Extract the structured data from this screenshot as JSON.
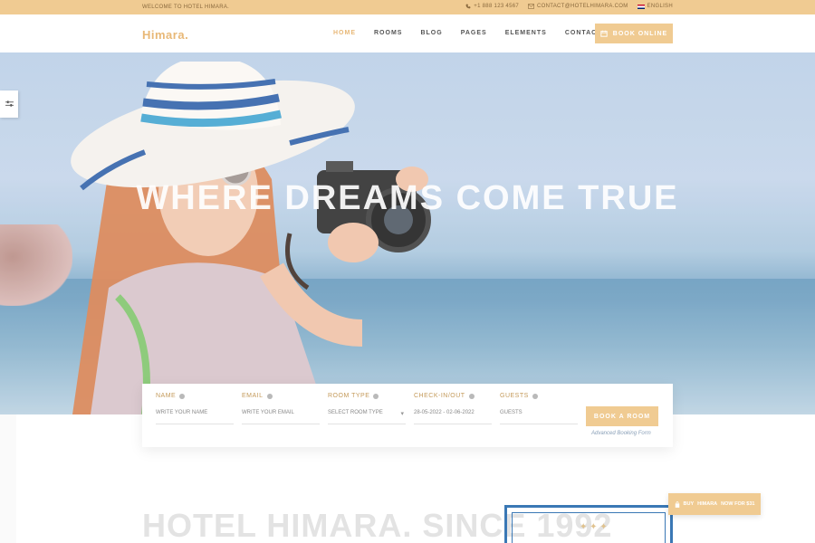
{
  "topbar": {
    "welcome": "WELCOME TO HOTEL HIMARA.",
    "phone": "+1 888 123 4567",
    "email": "CONTACT@HOTELHIMARA.COM",
    "language": "ENGLISH"
  },
  "header": {
    "logo": "Himara.",
    "nav": [
      "HOME",
      "ROOMS",
      "BLOG",
      "PAGES",
      "ELEMENTS",
      "CONTACT US"
    ],
    "active_nav": "HOME",
    "book_online": "BOOK ONLINE"
  },
  "hero": {
    "title": "WHERE DREAMS COME TRUE"
  },
  "booking": {
    "fields": [
      {
        "label": "NAME",
        "placeholder": "WRITE YOUR NAME"
      },
      {
        "label": "EMAIL",
        "placeholder": "WRITE YOUR EMAIL"
      },
      {
        "label": "ROOM TYPE",
        "placeholder": "SELECT ROOM TYPE"
      },
      {
        "label": "CHECK-IN/OUT",
        "placeholder": "28-05-2022 - 02-06-2022"
      },
      {
        "label": "GUESTS",
        "placeholder": "GUESTS"
      }
    ],
    "submit": "BOOK A ROOM",
    "advanced_link": "Advanced Booking Form"
  },
  "about": {
    "title": "HOTEL HIMARA. SINCE 1992"
  },
  "buy_badge": {
    "brand": "HIMARA",
    "prefix": "BUY",
    "suffix": "NOW FOR $31"
  },
  "colors": {
    "accent": "#f0cb92",
    "accent_text": "#e8b877",
    "logo_blue": "#3a78b5"
  }
}
